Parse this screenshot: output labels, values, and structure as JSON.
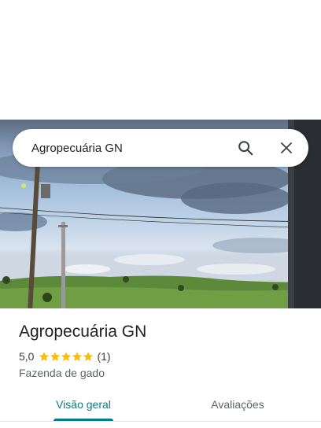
{
  "search": {
    "query": "Agropecuária GN"
  },
  "place": {
    "name": "Agropecuária GN",
    "rating": "5,0",
    "stars": 5,
    "review_count": "(1)",
    "category": "Fazenda de gado"
  },
  "tabs": [
    {
      "label": "Visão geral",
      "selected": true
    },
    {
      "label": "Avaliações",
      "selected": false
    }
  ],
  "colors": {
    "accent": "#0b7b80",
    "star": "#fbbc04"
  },
  "icons": {
    "search": "search-icon",
    "close": "close-icon",
    "star": "star-icon"
  }
}
